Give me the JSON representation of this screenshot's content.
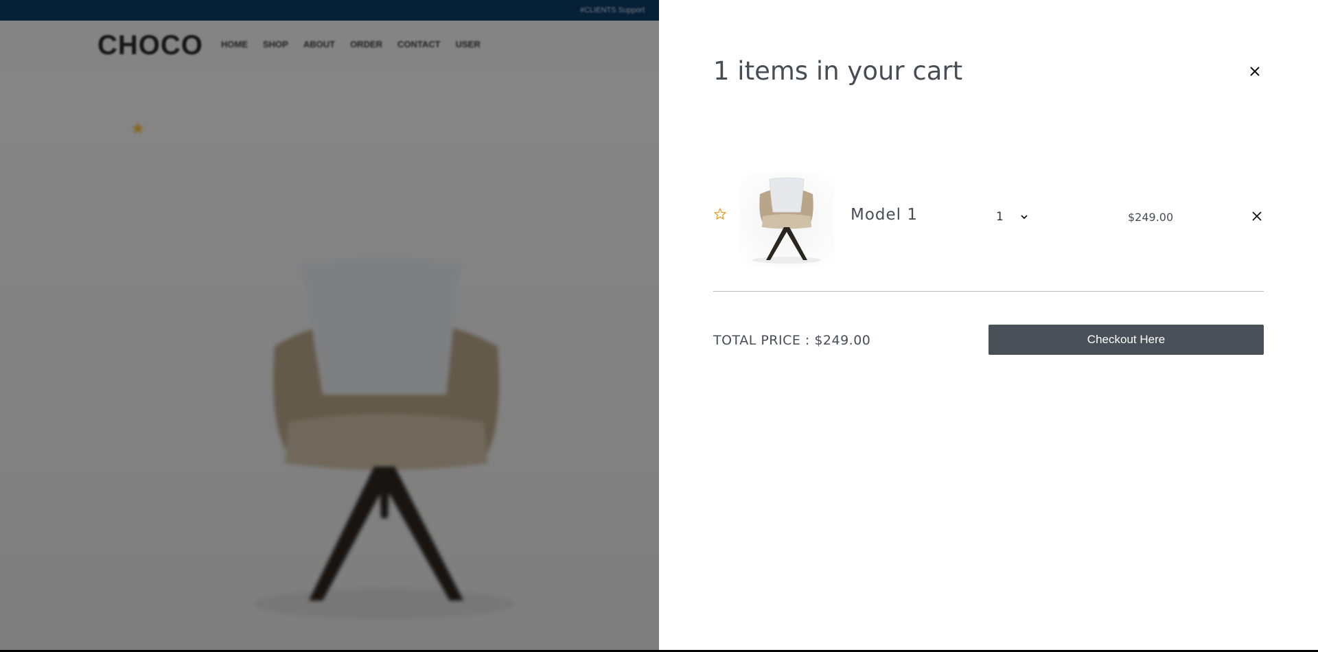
{
  "background_page": {
    "topbar_text": "#CLIENTS Support",
    "logo": "CHOCO",
    "nav": [
      "HOME",
      "SHOP",
      "ABOUT",
      "ORDER",
      "CONTACT",
      "USER"
    ]
  },
  "cart": {
    "title": "1 items in your cart",
    "items": [
      {
        "name": "Model 1",
        "quantity": "1",
        "price": "$249.00",
        "star_icon": "star-outline-icon",
        "remove_icon": "close-icon"
      }
    ],
    "total_label": "TOTAL PRICE : $249.00",
    "checkout_label": "Checkout Here",
    "close_icon": "close-icon"
  },
  "colors": {
    "topbar": "#0c3b66",
    "star": "#e2a52a",
    "checkout_button": "#4a5058",
    "text": "#474d54"
  }
}
